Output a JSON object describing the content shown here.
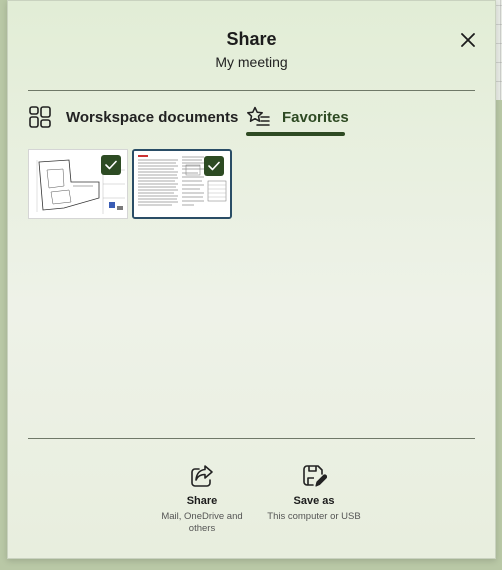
{
  "dialog": {
    "title": "Share",
    "subtitle": "My meeting"
  },
  "tabs": [
    {
      "label": "Worskspace documents",
      "icon": "grid-layout-icon",
      "selected": false
    },
    {
      "label": "Favorites",
      "icon": "star-list-icon",
      "selected": true
    }
  ],
  "thumbnails": [
    {
      "kind": "floor-plan",
      "checked": true
    },
    {
      "kind": "text-document",
      "checked": true
    }
  ],
  "actions": {
    "share": {
      "label": "Share",
      "description": "Mail, OneDrive and others",
      "icon": "share-icon"
    },
    "save_as": {
      "label": "Save as",
      "description": "This computer or USB",
      "icon": "save-edit-icon"
    }
  },
  "colors": {
    "accent": "#2e4a23",
    "selection_border": "#2a4d66"
  }
}
